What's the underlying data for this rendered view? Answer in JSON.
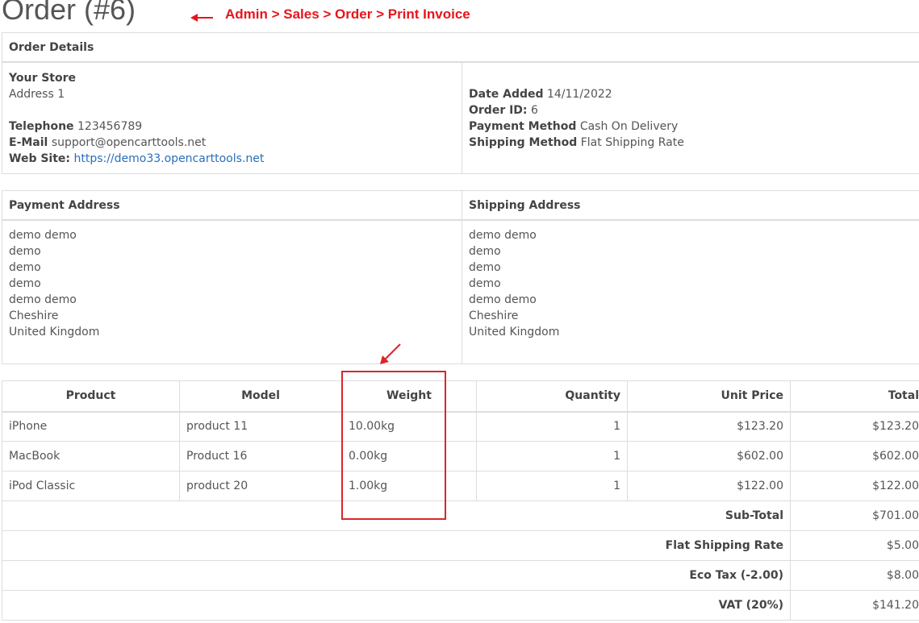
{
  "page": {
    "title": "Order (#6)"
  },
  "annotation": {
    "breadcrumb": "Admin > Sales > Order > Print Invoice",
    "color": "#e8141b"
  },
  "order_details": {
    "heading": "Order Details",
    "store": {
      "name": "Your Store",
      "address": "Address 1",
      "telephone_label": "Telephone",
      "telephone": "123456789",
      "email_label": "E-Mail",
      "email": "support@opencarttools.net",
      "website_label": "Web Site:",
      "website": "https://demo33.opencarttools.net"
    },
    "info": {
      "date_added_label": "Date Added",
      "date_added": "14/11/2022",
      "order_id_label": "Order ID:",
      "order_id": "6",
      "payment_method_label": "Payment Method",
      "payment_method": "Cash On Delivery",
      "shipping_method_label": "Shipping Method",
      "shipping_method": "Flat Shipping Rate"
    }
  },
  "addresses": {
    "payment_heading": "Payment Address",
    "shipping_heading": "Shipping Address",
    "payment_lines": [
      "demo demo",
      "demo",
      "demo",
      "demo",
      "demo demo",
      "Cheshire",
      "United Kingdom"
    ],
    "shipping_lines": [
      "demo demo",
      "demo",
      "demo",
      "demo",
      "demo demo",
      "Cheshire",
      "United Kingdom"
    ]
  },
  "products": {
    "headers": {
      "product": "Product",
      "model": "Model",
      "weight": "Weight",
      "quantity": "Quantity",
      "unit_price": "Unit Price",
      "total": "Total"
    },
    "rows": [
      {
        "product": "iPhone",
        "model": "product 11",
        "weight": "10.00kg",
        "quantity": "1",
        "unit_price": "$123.20",
        "total": "$123.20"
      },
      {
        "product": "MacBook",
        "model": "Product 16",
        "weight": "0.00kg",
        "quantity": "1",
        "unit_price": "$602.00",
        "total": "$602.00"
      },
      {
        "product": "iPod Classic",
        "model": "product 20",
        "weight": "1.00kg",
        "quantity": "1",
        "unit_price": "$122.00",
        "total": "$122.00"
      }
    ],
    "totals": [
      {
        "label": "Sub-Total",
        "value": "$701.00"
      },
      {
        "label": "Flat Shipping Rate",
        "value": "$5.00"
      },
      {
        "label": "Eco Tax (-2.00)",
        "value": "$8.00"
      },
      {
        "label": "VAT (20%)",
        "value": "$141.20"
      }
    ]
  },
  "colors": {
    "border": "#dddddd",
    "text": "#555555",
    "link": "#2a6ebb",
    "highlight": "#d9262c"
  }
}
